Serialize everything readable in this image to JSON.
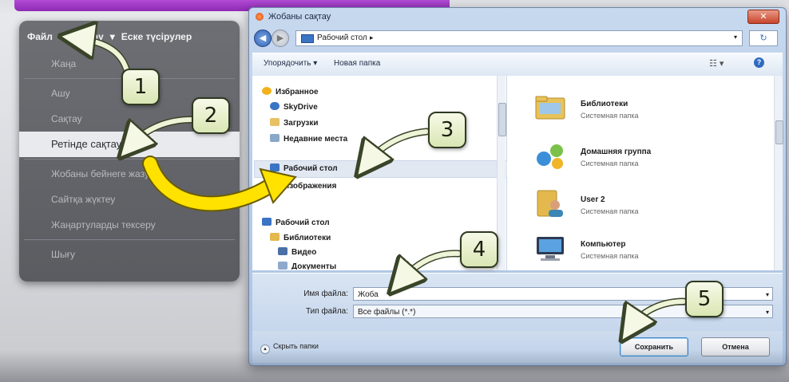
{
  "app_menu": {
    "header": [
      "Файл",
      "Баптау",
      "Еске түсірулер"
    ],
    "header_arrow": "▾",
    "items": [
      {
        "label": "Жаңа",
        "active": false
      },
      {
        "label": "Ашу",
        "active": false
      },
      {
        "label": "Сақтау",
        "active": false
      },
      {
        "label": "Ретінде сақтау",
        "active": true
      },
      {
        "label": "Жобаны бейнеге жазу",
        "active": false
      },
      {
        "label": "Сайтқа жүктеу",
        "active": false
      },
      {
        "label": "Жаңартуларды тексеру",
        "active": false
      },
      {
        "label": "Шығу",
        "active": false
      }
    ]
  },
  "dialog": {
    "title": "Жобаны сақтау",
    "close_label": "✕",
    "address": {
      "path": "Рабочий стол",
      "arrow": "▸"
    },
    "toolbar": {
      "organize": "Упорядочить ▾",
      "new_folder": "Новая папка",
      "view_icon": "view-icon",
      "help": "?"
    },
    "nav_pane": [
      {
        "label": "Избранное",
        "icon": "star-icon",
        "color": "#f2b21b"
      },
      {
        "label": "SkyDrive",
        "icon": "cloud-icon",
        "color": "#3a74c4"
      },
      {
        "label": "Загрузки",
        "icon": "downloads-icon",
        "color": "#e7c164"
      },
      {
        "label": "Недавние места",
        "icon": "recent-icon",
        "color": "#8aa6c8"
      },
      {
        "label": "Рабочий стол",
        "icon": "desktop-icon",
        "color": "#3a74c4"
      },
      {
        "label": "Изображения",
        "icon": "pictures-icon",
        "color": "#6fa65c"
      },
      {
        "label": "Рабочий стол",
        "icon": "desktop-icon",
        "color": "#3a74c4"
      },
      {
        "label": "Библиотеки",
        "icon": "libraries-icon",
        "color": "#e3b94e"
      },
      {
        "label": "Видео",
        "icon": "video-icon",
        "color": "#4a6fa5"
      },
      {
        "label": "Документы",
        "icon": "documents-icon",
        "color": "#8fa9cc"
      }
    ],
    "files": [
      {
        "name": "Библиотеки",
        "type": "Системная папка",
        "icon": "libraries-folder-icon"
      },
      {
        "name": "Домашняя группа",
        "type": "Системная папка",
        "icon": "homegroup-icon"
      },
      {
        "name": "User 2",
        "type": "Системная папка",
        "icon": "user-folder-icon"
      },
      {
        "name": "Компьютер",
        "type": "Системная папка",
        "icon": "computer-icon"
      }
    ],
    "filename_label": "Имя файла:",
    "filename_value": "Жоба",
    "filetype_label": "Тип файла:",
    "filetype_value": "Все файлы (*.*)",
    "hide_folders": "Скрыть папки",
    "save_button": "Сохранить",
    "cancel_button": "Отмена"
  },
  "callouts": [
    "1",
    "2",
    "3",
    "4",
    "5"
  ],
  "colors": {
    "arrow_yellow": "#ffe200",
    "callout_fill": "#e8efcc",
    "dialog_frame": "#b8cde8"
  }
}
